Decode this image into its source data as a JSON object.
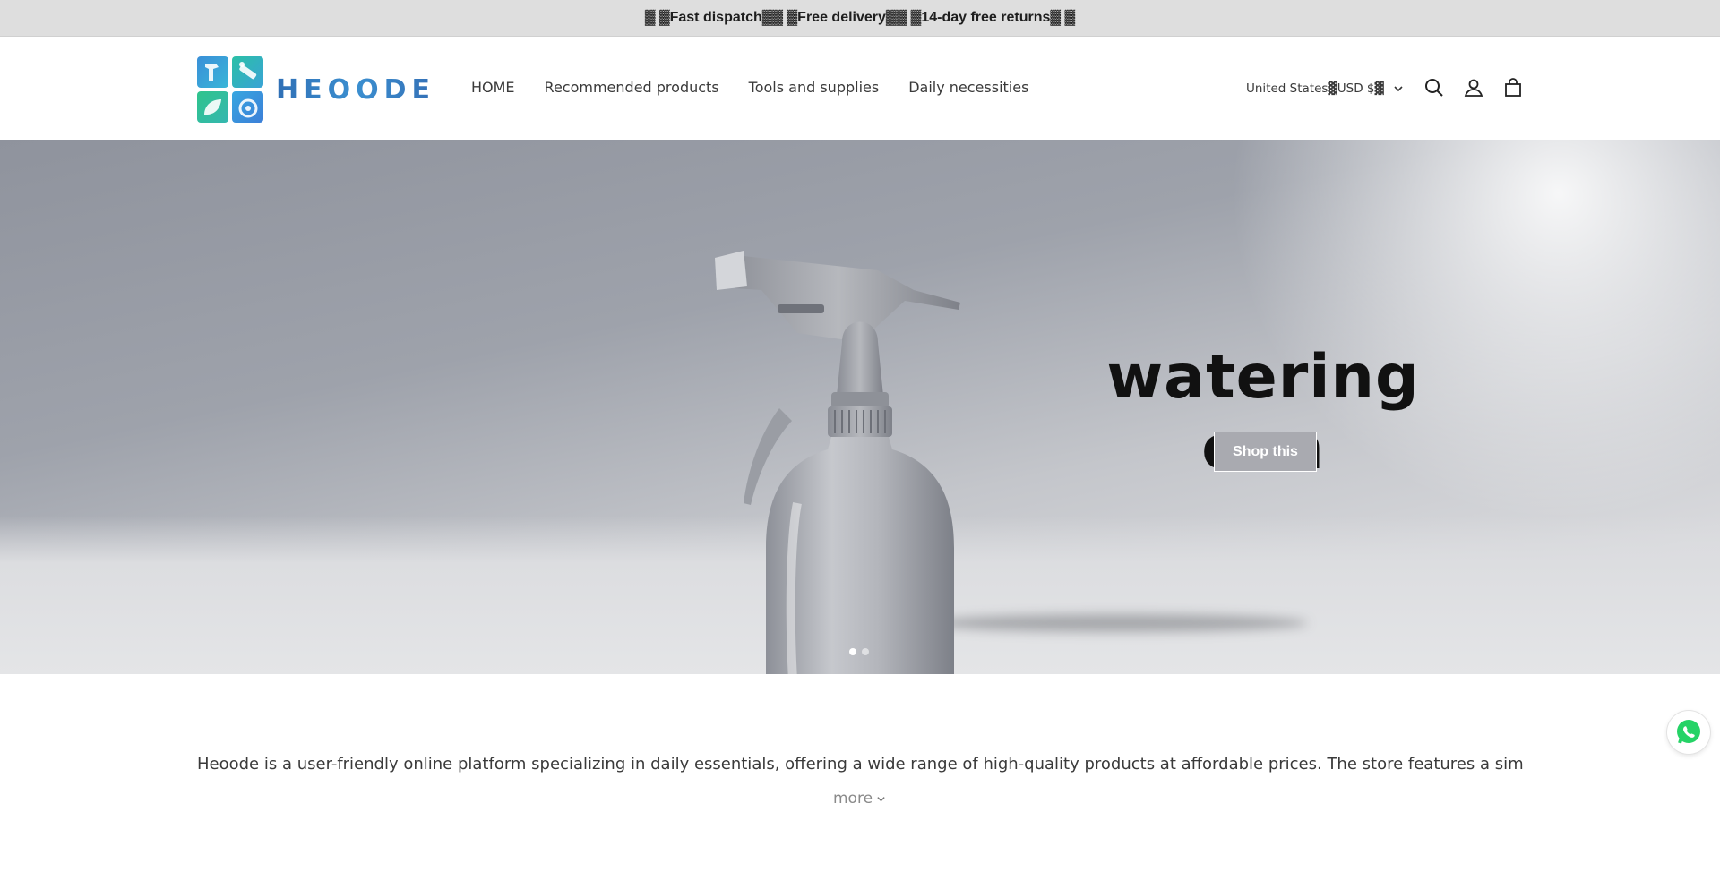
{
  "announcement": {
    "text": "▓ ▓Fast dispatch▓▓ ▓Free delivery▓▓ ▓14-day free returns▓ ▓"
  },
  "header": {
    "logo_text": "HEOODE",
    "nav": [
      {
        "label": "HOME"
      },
      {
        "label": "Recommended products"
      },
      {
        "label": "Tools and supplies"
      },
      {
        "label": "Daily necessities"
      }
    ],
    "locale": "United States▓USD $▓",
    "icons": [
      "search-icon",
      "account-icon",
      "cart-icon"
    ]
  },
  "hero": {
    "title": "watering can",
    "button_label": "Shop this",
    "slides": 2,
    "active_slide": 1
  },
  "about": {
    "text": "Heoode is a user-friendly online platform specializing in daily essentials, offering a wide range of high-quality products at affordable prices. The store features a simple",
    "more_label": "more"
  },
  "widgets": {
    "chat": "whatsapp-icon"
  },
  "colors": {
    "announcement_bg": "#dedede",
    "logo_blue": "#3470b6",
    "whatsapp_green": "#25d366"
  }
}
